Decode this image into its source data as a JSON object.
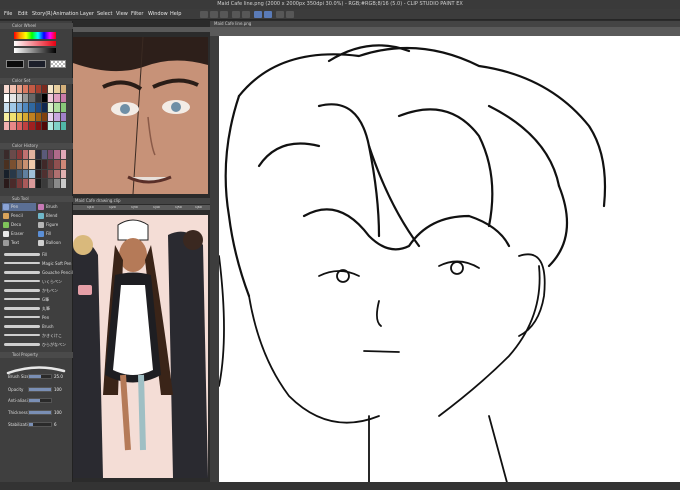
{
  "window": {
    "title": "Maid Cafe line.png (2000 x 2000px 350dpi 30.0%)  - RGB;#RGB;8/16 (5.0) - CLIP STUDIO PAINT EX"
  },
  "menu": {
    "items": [
      "File",
      "Edit",
      "Story(R)",
      "Animation",
      "Layer",
      "Select",
      "View",
      "Filter",
      "Window",
      "Help"
    ]
  },
  "panels": {
    "color_wheel_title": "Color Wheel",
    "color_set_title": "Color Set",
    "color_history_title": "Color History",
    "sub_tool_title": "Sub Tool",
    "tool_property_title": "Tool Property",
    "canvas_tab": "Maid Cafe line.png",
    "navigator_title": "Maid Cafe drawing.clip"
  },
  "tools": [
    {
      "label": "Pen",
      "selected": true
    },
    {
      "label": "Brush",
      "selected": false
    },
    {
      "label": "Pencil",
      "selected": false
    },
    {
      "label": "Blend",
      "selected": false
    },
    {
      "label": "Deco",
      "selected": false
    },
    {
      "label": "Figure",
      "selected": false
    },
    {
      "label": "Eraser",
      "selected": false
    },
    {
      "label": "Fill",
      "selected": false
    },
    {
      "label": "Text",
      "selected": false
    },
    {
      "label": "Balloon",
      "selected": false
    }
  ],
  "brushes": [
    {
      "label": "Fill"
    },
    {
      "label": "Magic Soft Pen"
    },
    {
      "label": "Gouache Pencil"
    },
    {
      "label": "いくらペン"
    },
    {
      "label": "かもペン"
    },
    {
      "label": "G筆"
    },
    {
      "label": "丸筆"
    },
    {
      "label": "Pen"
    },
    {
      "label": "Brush"
    },
    {
      "label": "かきくけこ"
    },
    {
      "label": "ひらがなペン"
    }
  ],
  "properties": [
    {
      "label": "Brush Size",
      "value": "25.0",
      "fill": 0.55
    },
    {
      "label": "Opacity",
      "value": "100",
      "fill": 1.0
    },
    {
      "label": "Anti-aliasing",
      "value": "",
      "fill": 0.5
    },
    {
      "label": "Thickness",
      "value": "100",
      "fill": 1.0
    },
    {
      "label": "Stabilization",
      "value": "6",
      "fill": 0.2
    }
  ],
  "ruler_top": [
    "1|10",
    "1|20",
    "1|30",
    "1|40",
    "1|50",
    "1|60"
  ],
  "colors": {
    "main": "#0b0b0b",
    "sub": "#1c1f2a",
    "accent": "#5a7bb8"
  }
}
